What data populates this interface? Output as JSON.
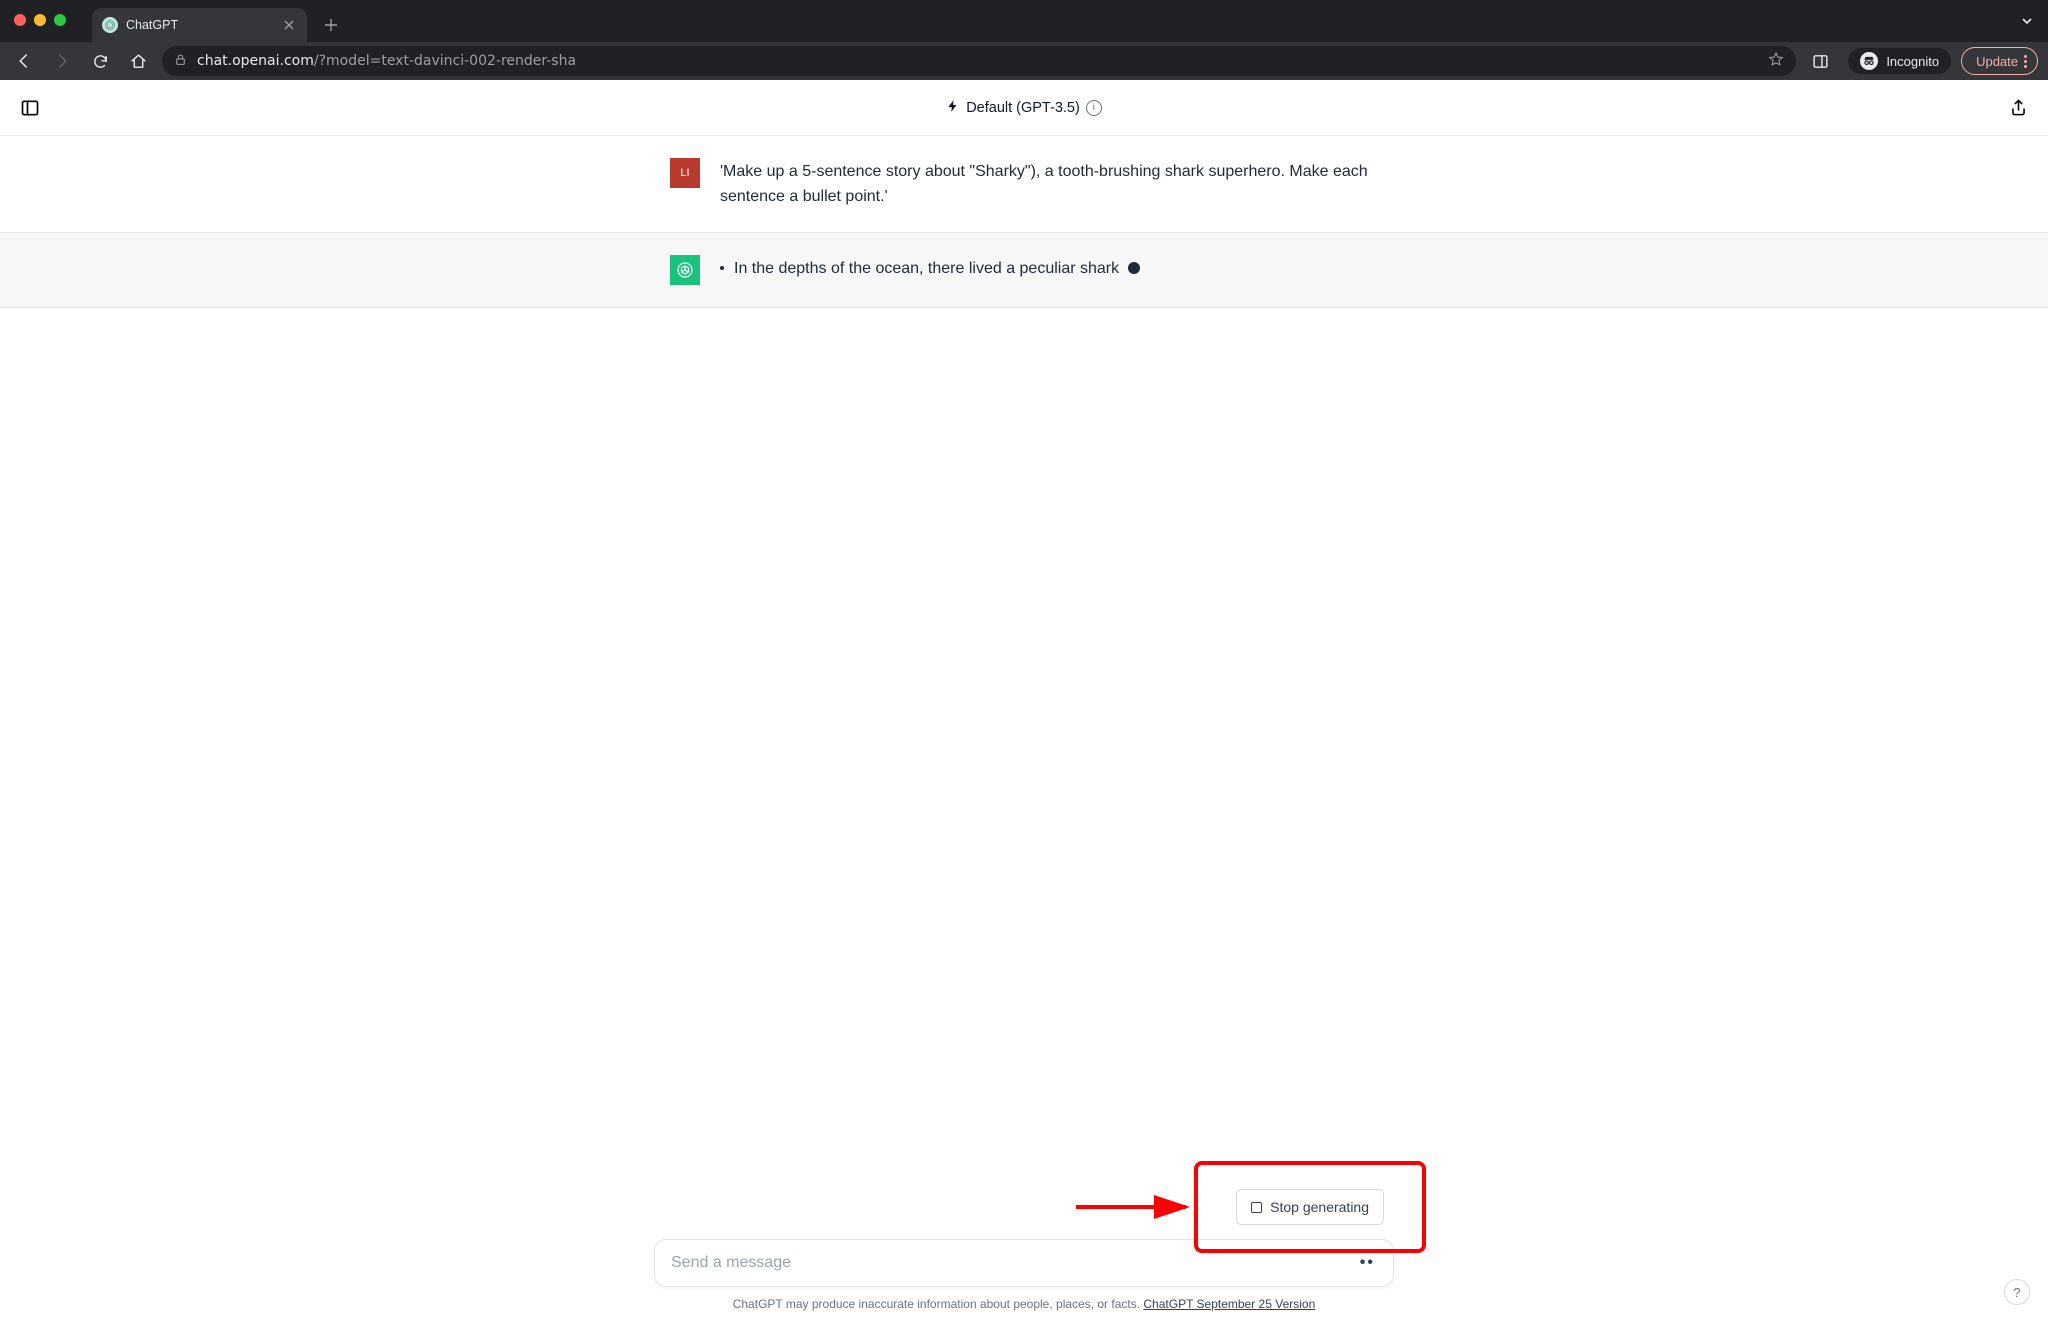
{
  "browser": {
    "tab_title": "ChatGPT",
    "url_host": "chat.openai.com",
    "url_path": "/?model=text-davinci-002-render-sha",
    "incognito_label": "Incognito",
    "update_label": "Update"
  },
  "header": {
    "model_label": "Default (GPT-3.5)"
  },
  "conversation": {
    "user_avatar_initials": "LI",
    "user_message": "'Make up a 5-sentence story about \"Sharky\"), a tooth-brushing shark superhero. Make each sentence a bullet point.'",
    "assistant_bullet_1": "In the depths of the ocean, there lived a peculiar shark"
  },
  "composer": {
    "placeholder": "Send a message",
    "stop_label": "Stop generating"
  },
  "footer": {
    "disclaimer_text": "ChatGPT may produce inaccurate information about people, places, or facts. ",
    "version_link": "ChatGPT September 25 Version"
  }
}
